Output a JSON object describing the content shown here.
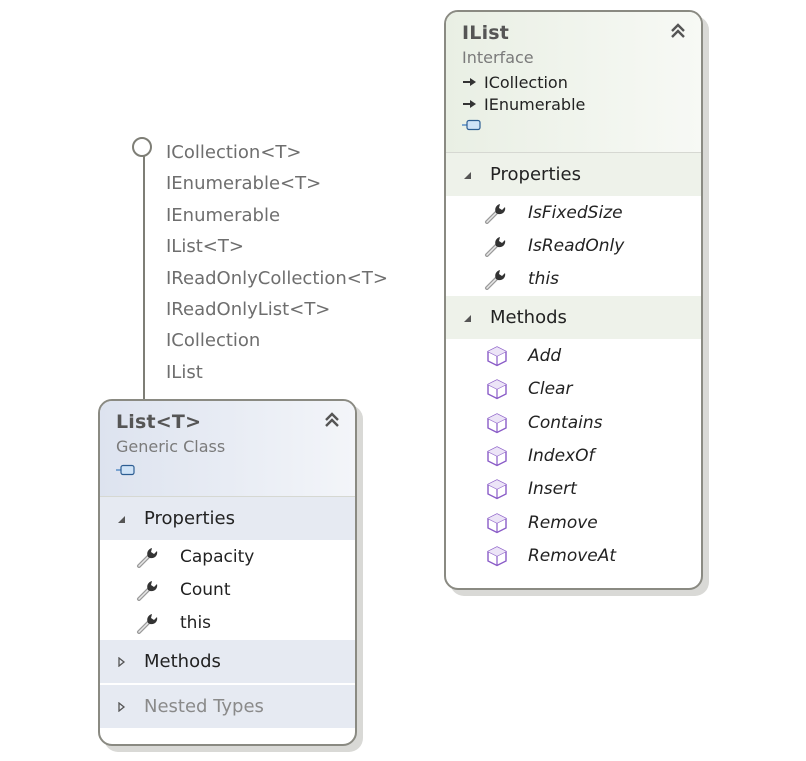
{
  "lollipop": {
    "interfaces": [
      "ICollection<T>",
      "IEnumerable<T>",
      "IEnumerable",
      "IList<T>",
      "IReadOnlyCollection<T>",
      "IReadOnlyList<T>",
      "ICollection",
      "IList"
    ]
  },
  "ilist": {
    "title": "IList",
    "stereotype": "Interface",
    "inherits": [
      "ICollection",
      "IEnumerable"
    ],
    "collapse_icon": "double-chevron-up-icon",
    "sections": {
      "properties": {
        "label": "Properties",
        "expanded": true,
        "items": [
          "IsFixedSize",
          "IsReadOnly",
          "this"
        ]
      },
      "methods": {
        "label": "Methods",
        "expanded": true,
        "items": [
          "Add",
          "Clear",
          "Contains",
          "IndexOf",
          "Insert",
          "Remove",
          "RemoveAt"
        ]
      }
    }
  },
  "listT": {
    "title": "List<T>",
    "stereotype": "Generic Class",
    "collapse_icon": "double-chevron-up-icon",
    "sections": {
      "properties": {
        "label": "Properties",
        "expanded": true,
        "items": [
          "Capacity",
          "Count",
          "this"
        ]
      },
      "methods": {
        "label": "Methods",
        "expanded": false
      },
      "nested": {
        "label": "Nested Types",
        "expanded": false
      }
    }
  },
  "colors": {
    "interface_header": "#e9efe4",
    "class_header": "#dde3ef",
    "method_icon": "#8a5cc7",
    "border": "#8a8a82"
  }
}
